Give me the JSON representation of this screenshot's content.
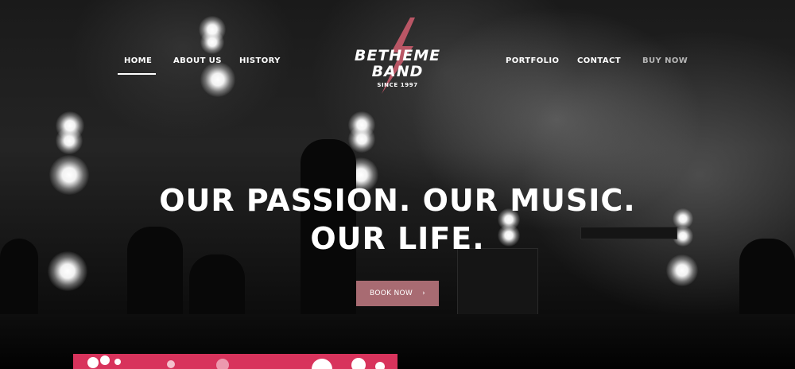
{
  "nav": {
    "left": [
      {
        "label": "HOME",
        "active": true
      },
      {
        "label": "ABOUT US",
        "active": false
      },
      {
        "label": "HISTORY",
        "active": false
      }
    ],
    "right": [
      {
        "label": "PORTFOLIO",
        "active": false
      },
      {
        "label": "CONTACT",
        "active": false
      },
      {
        "label": "BUY NOW",
        "active": false
      }
    ]
  },
  "logo": {
    "line1": "BETHEME",
    "line2": "BAND",
    "tagline": "SINCE 1997",
    "accent_color": "#c95b6b"
  },
  "hero": {
    "headline_line1": "OUR PASSION. OUR MUSIC.",
    "headline_line2": "OUR LIFE.",
    "cta_label": "BOOK NOW",
    "cta_arrow": "›",
    "cta_color": "#a86b72"
  },
  "colors": {
    "strip": "#d8335c",
    "text": "#ffffff",
    "muted_nav": "#b6b6b6"
  }
}
